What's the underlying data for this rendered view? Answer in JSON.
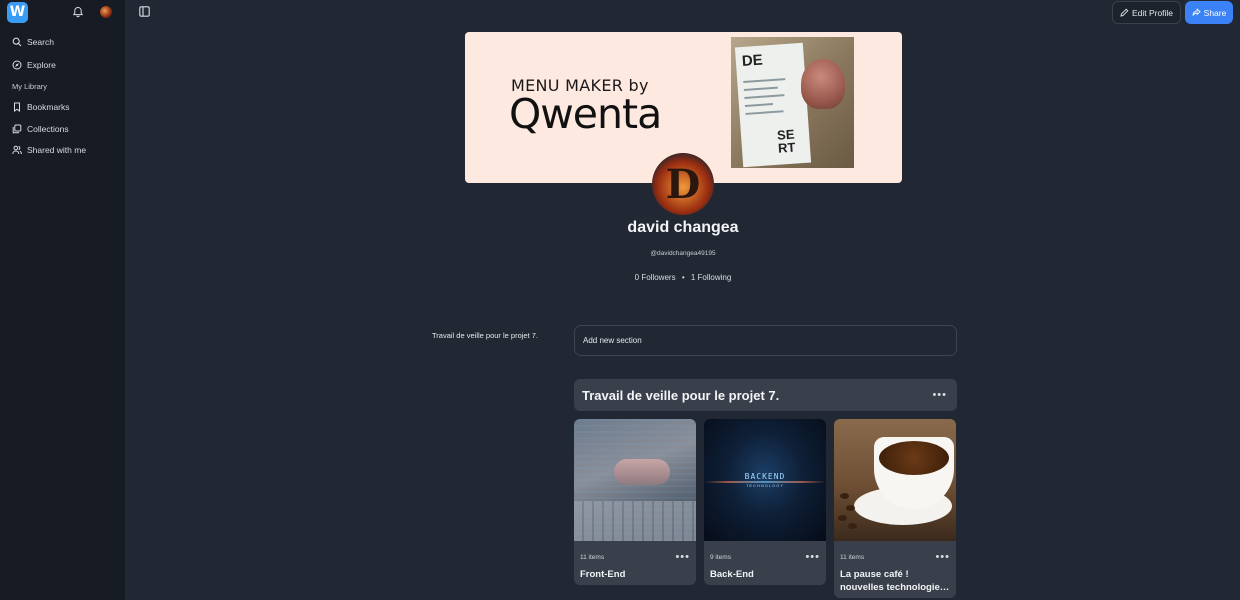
{
  "app": {
    "logo_letter": "W"
  },
  "sidebar": {
    "items": [
      {
        "label": "Search",
        "icon": "search-icon"
      },
      {
        "label": "Explore",
        "icon": "compass-icon"
      }
    ],
    "library_heading": "My Library",
    "library_items": [
      {
        "label": "Bookmarks",
        "icon": "bookmark-icon"
      },
      {
        "label": "Collections",
        "icon": "collections-icon"
      },
      {
        "label": "Shared with me",
        "icon": "shared-users-icon"
      }
    ]
  },
  "header": {
    "edit_profile_label": "Edit Profile",
    "share_label": "Share"
  },
  "banner": {
    "line1": "MENU MAKER by",
    "line2": "Qwenta",
    "menu_card_text_top": "DE",
    "menu_card_text_bottom": "SE\nRT"
  },
  "profile": {
    "avatar_letter": "D",
    "name": "david changea",
    "handle": "@davidchangea49195",
    "followers_text": "0 Followers",
    "following_text": "1 Following",
    "separator": "•"
  },
  "sections_nav": {
    "section_title": "Travail de veille pour le projet 7."
  },
  "add_section": {
    "label": "Add new section"
  },
  "section": {
    "title": "Travail de veille pour le projet 7.",
    "more_label": "•••",
    "collections": [
      {
        "count": "11 items",
        "name": "Front-End",
        "thumb": "frontend-thumb"
      },
      {
        "count": "9 items",
        "name": "Back-End",
        "thumb": "backend-thumb",
        "thumb_text_1": "BACKEND",
        "thumb_text_2": "TECHNOLOGY"
      },
      {
        "count": "11 items",
        "name": "La pause café ! nouvelles technologie…",
        "thumb": "coffee-thumb"
      }
    ]
  },
  "colors": {
    "background": "#222833",
    "sidebar": "#161b24",
    "accent": "#3b82f6",
    "card": "#3a404b"
  }
}
